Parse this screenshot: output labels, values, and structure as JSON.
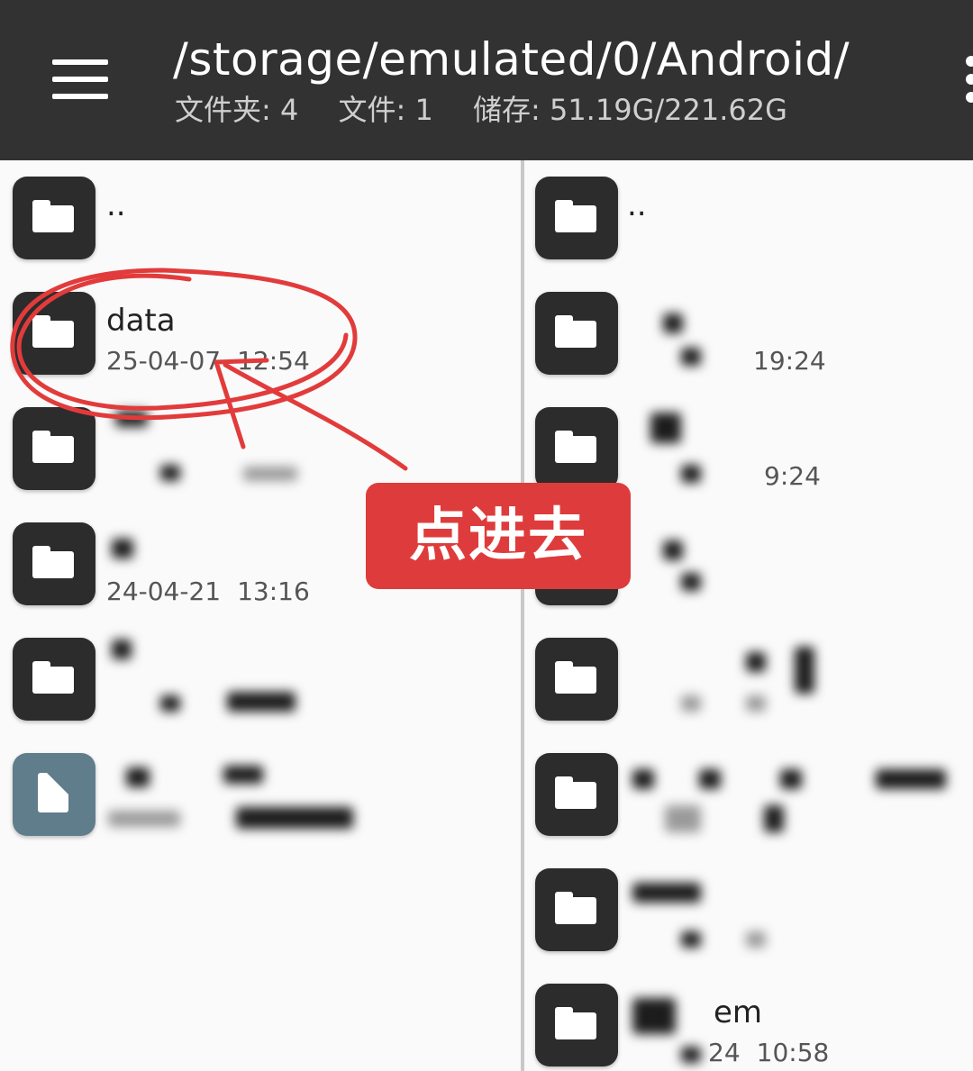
{
  "header": {
    "path": "/storage/emulated/0/Android/",
    "folders_label": "文件夹: 4",
    "files_label": "文件: 1",
    "storage_label": "储存: 51.19G/221.62G"
  },
  "left_pane": {
    "items": [
      {
        "name": "..",
        "meta": "",
        "time": ""
      },
      {
        "name": "data",
        "meta": "25-04-07",
        "time": "12:54"
      },
      {
        "name": "",
        "meta": "",
        "time": ""
      },
      {
        "name": "",
        "meta": "24-04-21",
        "time": "13:16"
      },
      {
        "name": "",
        "meta": "",
        "time": ""
      },
      {
        "name": "",
        "meta": "",
        "time": ""
      }
    ]
  },
  "right_pane": {
    "items": [
      {
        "name": "..",
        "meta": "",
        "time": ""
      },
      {
        "name": "",
        "meta": "",
        "time": "19:24"
      },
      {
        "name": "",
        "meta": "",
        "time": "9:24"
      },
      {
        "name": "",
        "meta": "",
        "time": ""
      },
      {
        "name": "",
        "meta": "",
        "time": ""
      },
      {
        "name": "",
        "meta": "",
        "time": ""
      },
      {
        "name": "",
        "meta": "",
        "time": ""
      },
      {
        "name": "em",
        "meta": "24",
        "time": "10:58"
      }
    ]
  },
  "annotation": {
    "callout_text": "点进去",
    "color": "#de3c3c"
  },
  "icons": {
    "menu": "hamburger-menu-icon",
    "overflow": "overflow-menu-icon",
    "folder": "folder-icon",
    "file": "file-icon"
  }
}
